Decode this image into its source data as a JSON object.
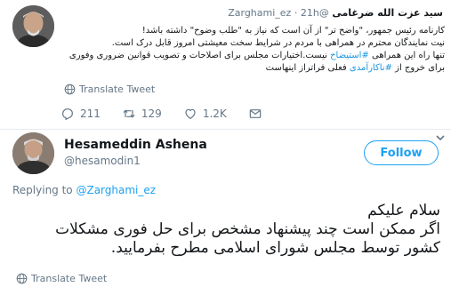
{
  "quoted": {
    "name": "سید عزت الله ضرغامی",
    "handle": "@Zarghami_ez",
    "time": "21h",
    "body_lines": [
      "کارنامه رئیس جمهور، \"واضح تر\" از آن است که نیاز به \"طلب وضوح\" داشته باشد!",
      "نیت نمایندگان محترم در همراهی با مردم در شرایط سخت معیشتی امروز قابل درک است.",
      "تنها راه این همراهی #استیضاح نیست.اختیارات مجلس برای اصلاحات و تصویب قوانین ضروری وفوری",
      "برای خروج از #ناکارآمدی فعلی فراتراز اینهاست"
    ],
    "hashtag_1": "#استیضاح",
    "hashtag_2": "#ناکارآمدی",
    "line3_after": " نیست.اختیارات مجلس برای اصلاحات و تصویب قوانین ضروری وفوری",
    "line3_before": "تنها راه این همراهی ",
    "line4_before": "برای خروج از ",
    "line4_after": " فعلی فراتراز اینهاست",
    "translate_label": "Translate Tweet",
    "reply_count": "211",
    "retweet_count": "129",
    "like_count": "1.2K"
  },
  "main": {
    "name": "Hesameddin Ashena",
    "handle": "@hesamodin1",
    "follow_label": "Follow",
    "replying_prefix": "Replying to",
    "replying_to": "@Zarghami_ez",
    "body_lines": [
      "سلام علیکم",
      "اگر ممکن است چند پیشنهاد مشخص برای حل فوری مشکلات",
      "کشور توسط مجلس شورای اسلامی مطرح بفرمایید."
    ],
    "translate_label": "Translate Tweet"
  },
  "colors": {
    "accent": "#1da1f2",
    "muted": "#657786",
    "text": "#14171a"
  }
}
